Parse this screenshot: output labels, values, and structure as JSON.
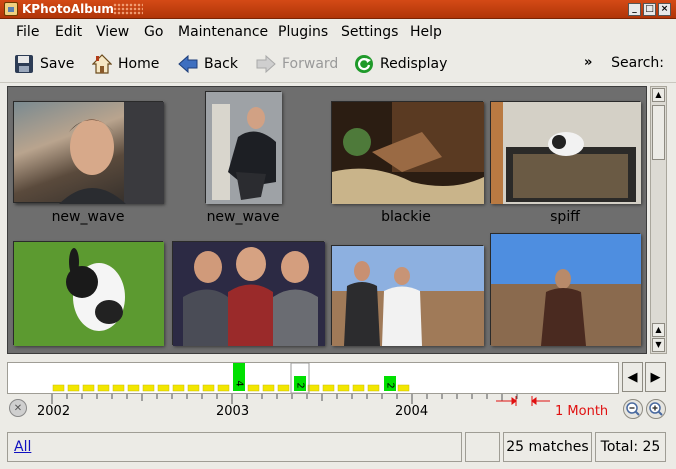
{
  "window": {
    "title": "KPhotoAlbum",
    "controls": [
      "_",
      "□",
      "×"
    ]
  },
  "menu": [
    "File",
    "Edit",
    "View",
    "Go",
    "Maintenance",
    "Plugins",
    "Settings",
    "Help"
  ],
  "toolbar": {
    "save": "Save",
    "home": "Home",
    "back": "Back",
    "forward": "Forward",
    "redisplay": "Redisplay",
    "chevron": "»",
    "search": "Search:"
  },
  "thumbnails": [
    {
      "label": "new_wave"
    },
    {
      "label": "new_wave"
    },
    {
      "label": "blackie"
    },
    {
      "label": "spiff"
    },
    {
      "label": ""
    },
    {
      "label": ""
    },
    {
      "label": ""
    },
    {
      "label": ""
    }
  ],
  "timeline": {
    "bars": [
      {
        "label": "4"
      },
      {
        "label": "2"
      },
      {
        "label": "2"
      }
    ],
    "years": [
      "2002",
      "2003",
      "2004"
    ],
    "unit": "1 Month"
  },
  "status": {
    "link": "All",
    "matches": "25 matches",
    "total": "Total: 25"
  },
  "colors": {
    "title_bar": "#c23f0c",
    "timeline_bar": "#00e000",
    "timeline_slot": "#f2e600"
  }
}
